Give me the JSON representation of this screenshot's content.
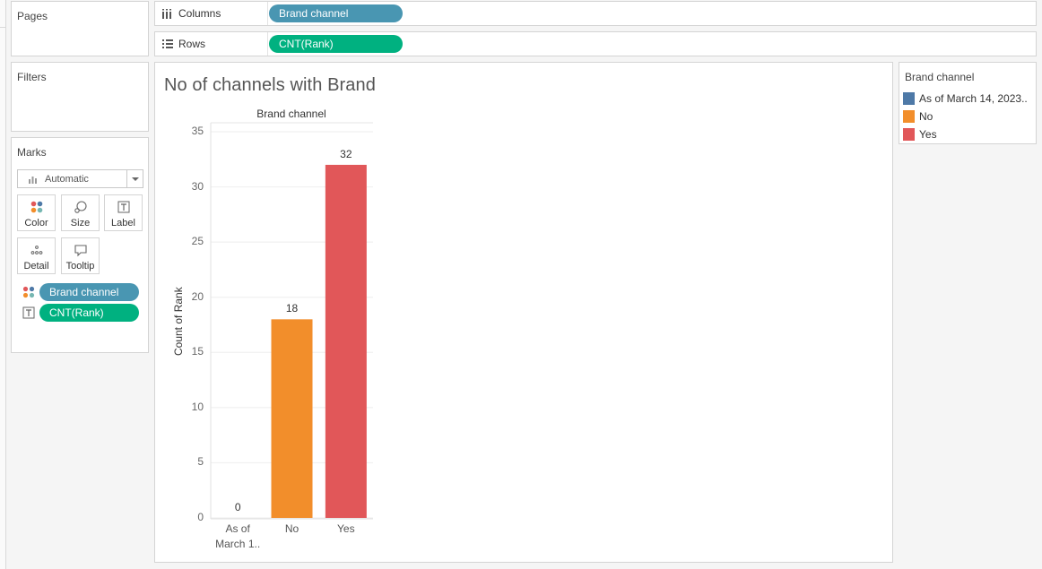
{
  "cards": {
    "pages": "Pages",
    "filters": "Filters",
    "marks": "Marks"
  },
  "shelves": {
    "columns": {
      "label": "Columns",
      "pill": "Brand channel"
    },
    "rows": {
      "label": "Rows",
      "pill": "CNT(Rank)"
    }
  },
  "marks": {
    "mark_type": "Automatic",
    "buttons": {
      "color": "Color",
      "size": "Size",
      "label": "Label",
      "detail": "Detail",
      "tooltip": "Tooltip"
    },
    "fields": [
      {
        "icon": "color-icon",
        "name": "Brand channel",
        "color": "#4996b2"
      },
      {
        "icon": "label-icon",
        "name": "CNT(Rank)",
        "color": "#00b180"
      }
    ]
  },
  "view": {
    "title": "No of channels with Brand"
  },
  "legend": {
    "title": "Brand channel",
    "items": [
      {
        "label": "As of March 14, 2023..",
        "color": "#4e79a7"
      },
      {
        "label": "No",
        "color": "#f28e2b"
      },
      {
        "label": "Yes",
        "color": "#e15759"
      }
    ]
  },
  "chart_data": {
    "type": "bar",
    "title": "No of channels with Brand",
    "column_header": "Brand channel",
    "categories": [
      "As of March 1..",
      "No",
      "Yes"
    ],
    "category_lines": [
      [
        "As of",
        "March 1.."
      ],
      [
        "No"
      ],
      [
        "Yes"
      ]
    ],
    "values": [
      0,
      18,
      32
    ],
    "colors": [
      "#4e79a7",
      "#f28e2b",
      "#e15759"
    ],
    "ylabel": "Count of Rank",
    "xlabel": "",
    "ylim": [
      0,
      35
    ],
    "yticks": [
      0,
      5,
      10,
      15,
      20,
      25,
      30,
      35
    ],
    "grid": true
  }
}
